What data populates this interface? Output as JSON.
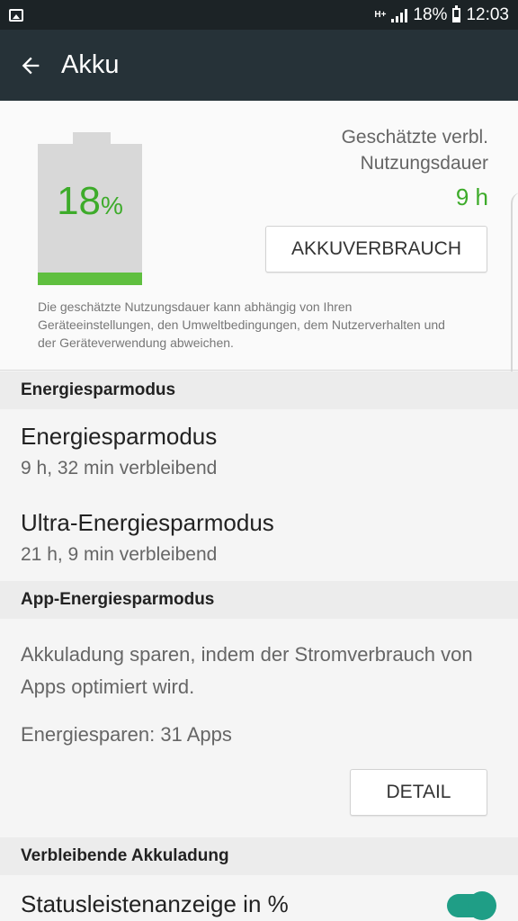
{
  "status_bar": {
    "network": "H+",
    "battery_percent": "18%",
    "time": "12:03",
    "icons": [
      "gallery-icon",
      "network-type-icon",
      "signal-icon",
      "battery-icon"
    ]
  },
  "app_bar": {
    "title": "Akku",
    "back_icon": "arrow-left-icon"
  },
  "battery": {
    "percent_number": "18",
    "percent_symbol": "%",
    "level": 0.18,
    "estimate_label": "Geschätzte verbl. Nutzungsdauer",
    "estimate_value": "9 h",
    "usage_button": "AKKUVERBRAUCH",
    "disclaimer": "Die geschätzte Nutzungsdauer kann abhängig von Ihren Geräteeinstellungen, den Umweltbedingungen, dem Nutzerverhalten und der Geräteverwendung abweichen.",
    "fill_color": "#5fbf3f",
    "accent_color": "#3dab2a"
  },
  "power_saving": {
    "header": "Energiesparmodus",
    "items": [
      {
        "title": "Energiesparmodus",
        "subtitle": "9 h, 32 min verbleibend"
      },
      {
        "title": "Ultra-Energiesparmodus",
        "subtitle": "21 h, 9 min verbleibend"
      }
    ]
  },
  "app_power_saving": {
    "header": "App-Energiesparmodus",
    "description": "Akkuladung sparen, indem der Stromverbrauch von Apps optimiert wird.",
    "count": "Energiesparen: 31 Apps",
    "detail_button": "DETAIL"
  },
  "remaining": {
    "header": "Verbleibende Akkuladung",
    "toggle_label": "Statusleistenanzeige in %",
    "toggle_on": true,
    "toggle_color": "#1f9e86"
  }
}
